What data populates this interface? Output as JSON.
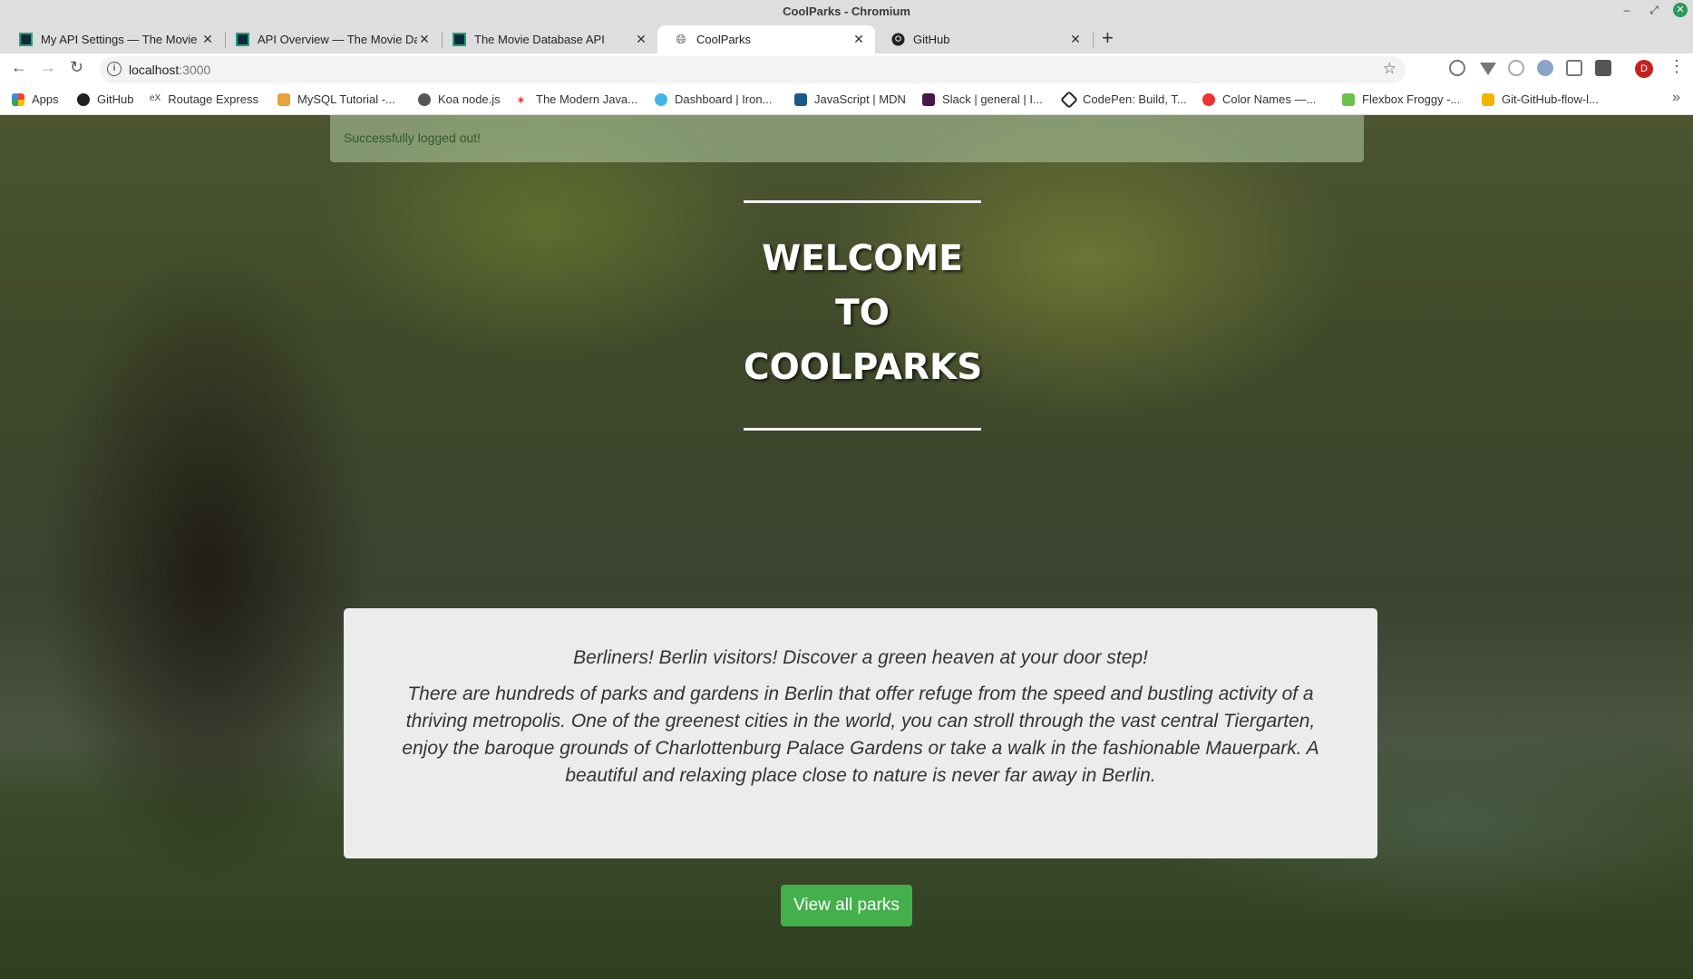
{
  "window": {
    "title": "CoolParks - Chromium"
  },
  "tabs": [
    {
      "label": "My API Settings — The Movie Database"
    },
    {
      "label": "API Overview — The Movie Database"
    },
    {
      "label": "The Movie Database API"
    },
    {
      "label": "CoolParks"
    },
    {
      "label": "GitHub"
    }
  ],
  "address_bar": {
    "host": "localhost",
    "port": ":3000"
  },
  "bookmarks": [
    {
      "label": "Apps"
    },
    {
      "label": "GitHub"
    },
    {
      "label": "Routage Express"
    },
    {
      "label": "MySQL Tutorial -..."
    },
    {
      "label": "Koa node.js"
    },
    {
      "label": "The Modern Java..."
    },
    {
      "label": "Dashboard | Iron..."
    },
    {
      "label": "JavaScript | MDN"
    },
    {
      "label": "Slack | general | I..."
    },
    {
      "label": "CodePen: Build, T..."
    },
    {
      "label": "Color Names —..."
    },
    {
      "label": "Flexbox Froggy -..."
    },
    {
      "label": "Git-GitHub-flow-l..."
    }
  ],
  "profile": {
    "initial": "D"
  },
  "page": {
    "flash": "Successfully logged out!",
    "welcome": {
      "line1": "WELCOME",
      "line2": "TO",
      "line3": "COOLPARKS"
    },
    "intro": {
      "lead": "Berliners! Berlin visitors! Discover a green heaven at your door step!",
      "body": "There are hundreds of parks and gardens in Berlin that offer refuge from the speed and bustling activity of a thriving metropolis. One of the greenest cities in the world, you can stroll through the vast central Tiergarten, enjoy the baroque grounds of Charlottenburg Palace Gardens or take a walk in the fashionable Mauerpark. A beautiful and relaxing place close to nature is never far away in Berlin."
    },
    "cta_label": "View all parks"
  },
  "colors": {
    "button_green": "#43b04c",
    "avatar_red": "#c5221f"
  }
}
